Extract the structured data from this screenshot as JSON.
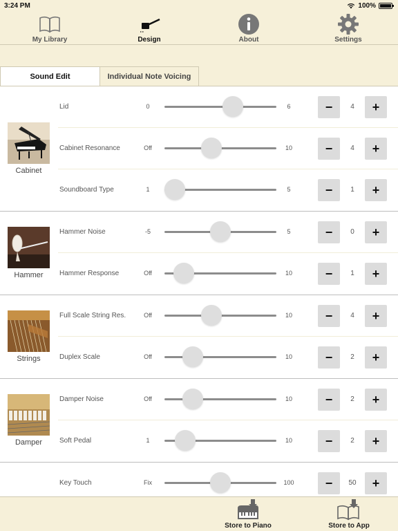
{
  "status": {
    "time": "3:24 PM",
    "battery": "100%"
  },
  "nav": [
    {
      "label": "My Library",
      "icon": "book-icon"
    },
    {
      "label": "Design",
      "icon": "hammer-icon"
    },
    {
      "label": "About",
      "icon": "info-icon"
    },
    {
      "label": "Settings",
      "icon": "gear-icon"
    }
  ],
  "tabs": {
    "sound_edit": "Sound Edit",
    "note_voicing": "Individual Note Voicing"
  },
  "groups": [
    {
      "label": "Cabinet",
      "rows": [
        {
          "name": "Lid",
          "min": "0",
          "max": "6",
          "value": "4",
          "fraction": 0.64
        },
        {
          "name": "Cabinet Resonance",
          "min": "Off",
          "max": "10",
          "value": "4",
          "fraction": 0.4
        },
        {
          "name": "Soundboard Type",
          "min": "1",
          "max": "5",
          "value": "1",
          "fraction": 0.0
        }
      ]
    },
    {
      "label": "Hammer",
      "rows": [
        {
          "name": "Hammer Noise",
          "min": "-5",
          "max": "5",
          "value": "0",
          "fraction": 0.5
        },
        {
          "name": "Hammer Response",
          "min": "Off",
          "max": "10",
          "value": "1",
          "fraction": 0.1
        }
      ]
    },
    {
      "label": "Strings",
      "rows": [
        {
          "name": "Full Scale String Res.",
          "min": "Off",
          "max": "10",
          "value": "4",
          "fraction": 0.4
        },
        {
          "name": "Duplex Scale",
          "min": "Off",
          "max": "10",
          "value": "2",
          "fraction": 0.2
        }
      ]
    },
    {
      "label": "Damper",
      "rows": [
        {
          "name": "Damper Noise",
          "min": "Off",
          "max": "10",
          "value": "2",
          "fraction": 0.2
        },
        {
          "name": "Soft Pedal",
          "min": "1",
          "max": "10",
          "value": "2",
          "fraction": 0.11
        }
      ]
    },
    {
      "label": "",
      "rows": [
        {
          "name": "Key Touch",
          "min": "Fix",
          "max": "100",
          "value": "50",
          "fraction": 0.5
        }
      ]
    }
  ],
  "bottom": {
    "store_piano": "Store to Piano",
    "store_app": "Store to App"
  },
  "colors": {
    "background": "#f6f0d9",
    "panel": "#ffffff",
    "button": "#dcdcdc",
    "track": "#8c8c8c"
  }
}
